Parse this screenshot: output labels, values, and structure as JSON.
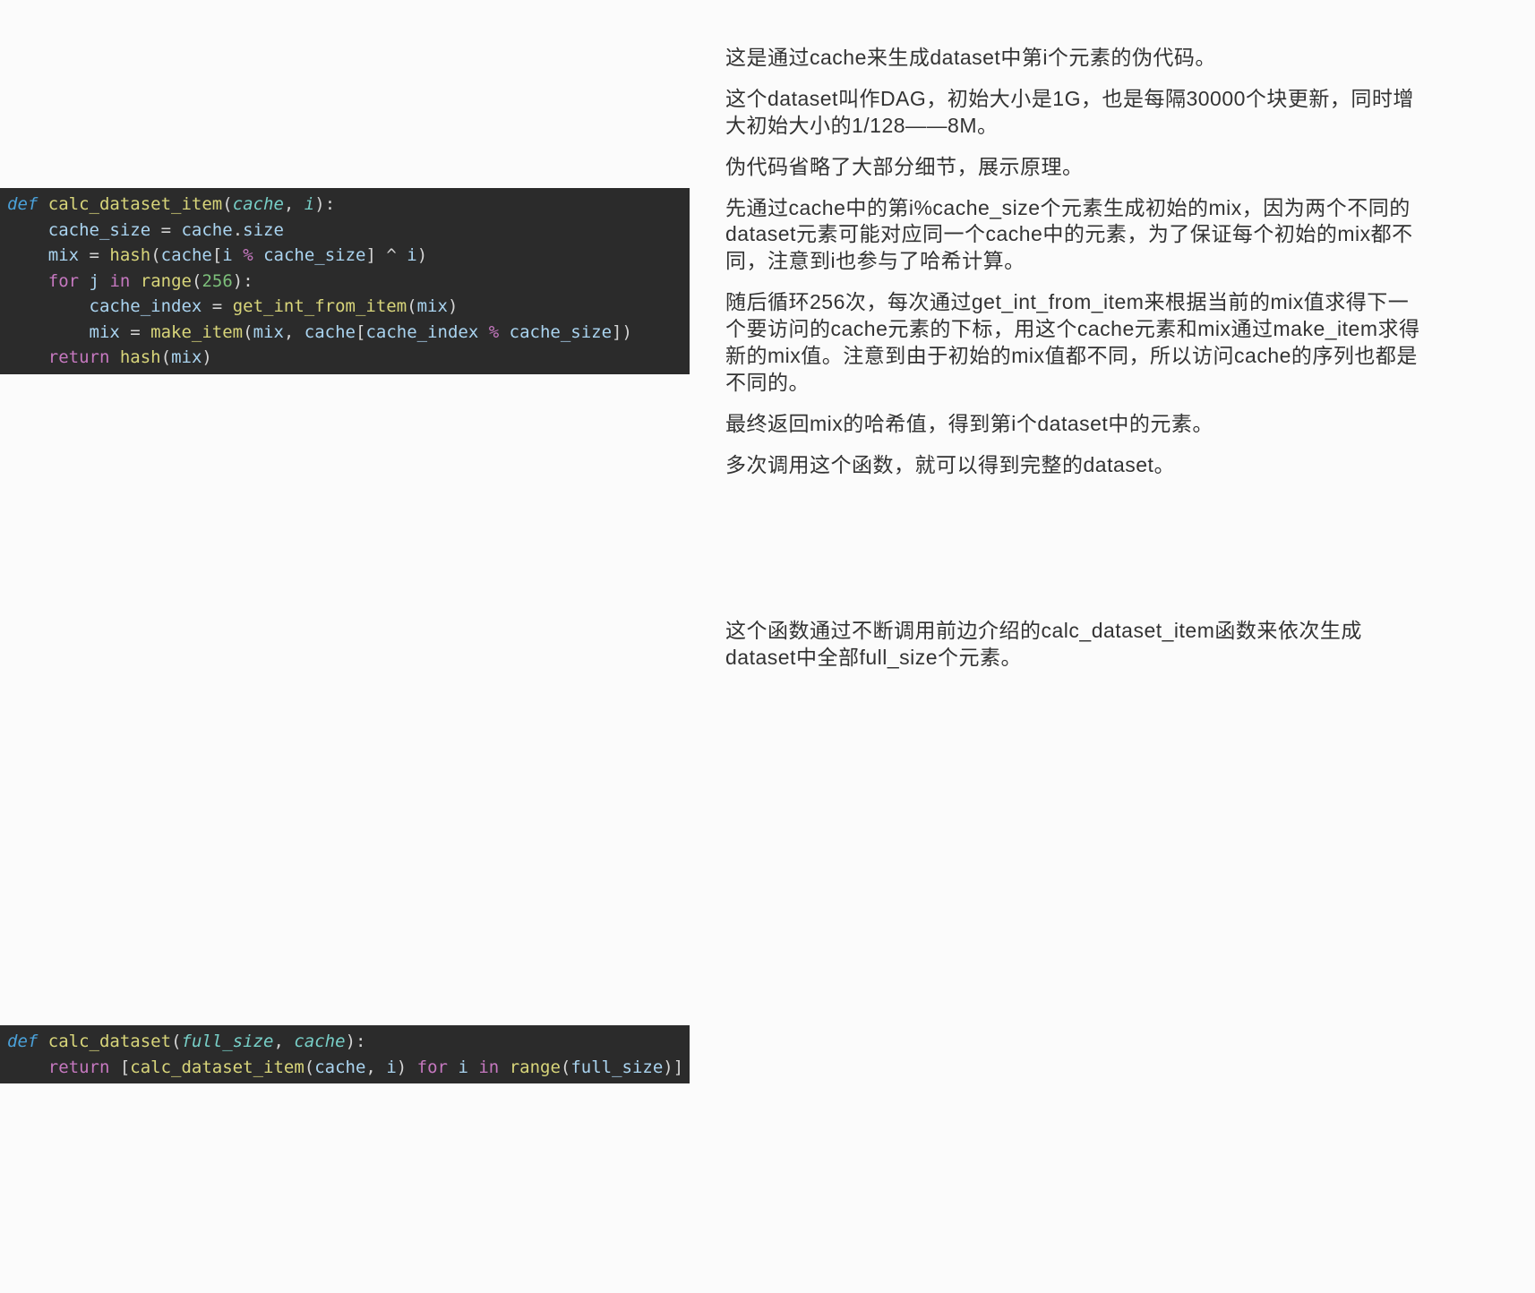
{
  "section1": {
    "code_lines": [
      [
        {
          "cls": "kw-def",
          "t": "def"
        },
        {
          "cls": "plain",
          "t": " "
        },
        {
          "cls": "fn-name",
          "t": "calc_dataset_item"
        },
        {
          "cls": "punct",
          "t": "("
        },
        {
          "cls": "param",
          "t": "cache"
        },
        {
          "cls": "punct",
          "t": ", "
        },
        {
          "cls": "param",
          "t": "i"
        },
        {
          "cls": "punct",
          "t": "):"
        }
      ],
      [
        {
          "cls": "plain",
          "t": "    "
        },
        {
          "cls": "var",
          "t": "cache_size"
        },
        {
          "cls": "plain",
          "t": " = "
        },
        {
          "cls": "var",
          "t": "cache"
        },
        {
          "cls": "punct",
          "t": "."
        },
        {
          "cls": "var",
          "t": "size"
        }
      ],
      [
        {
          "cls": "plain",
          "t": "    "
        },
        {
          "cls": "var",
          "t": "mix"
        },
        {
          "cls": "plain",
          "t": " = "
        },
        {
          "cls": "func",
          "t": "hash"
        },
        {
          "cls": "punct",
          "t": "("
        },
        {
          "cls": "var",
          "t": "cache"
        },
        {
          "cls": "punct",
          "t": "["
        },
        {
          "cls": "var",
          "t": "i"
        },
        {
          "cls": "plain",
          "t": " "
        },
        {
          "cls": "kw-ctrl",
          "t": "%"
        },
        {
          "cls": "plain",
          "t": " "
        },
        {
          "cls": "var",
          "t": "cache_size"
        },
        {
          "cls": "punct",
          "t": "] "
        },
        {
          "cls": "op",
          "t": "^"
        },
        {
          "cls": "plain",
          "t": " "
        },
        {
          "cls": "var",
          "t": "i"
        },
        {
          "cls": "punct",
          "t": ")"
        }
      ],
      [
        {
          "cls": "plain",
          "t": "    "
        },
        {
          "cls": "kw-ctrl",
          "t": "for"
        },
        {
          "cls": "plain",
          "t": " "
        },
        {
          "cls": "var",
          "t": "j"
        },
        {
          "cls": "plain",
          "t": " "
        },
        {
          "cls": "kw-ctrl",
          "t": "in"
        },
        {
          "cls": "plain",
          "t": " "
        },
        {
          "cls": "func",
          "t": "range"
        },
        {
          "cls": "punct",
          "t": "("
        },
        {
          "cls": "num",
          "t": "256"
        },
        {
          "cls": "punct",
          "t": "):"
        }
      ],
      [
        {
          "cls": "plain",
          "t": "        "
        },
        {
          "cls": "var",
          "t": "cache_index"
        },
        {
          "cls": "plain",
          "t": " = "
        },
        {
          "cls": "func",
          "t": "get_int_from_item"
        },
        {
          "cls": "punct",
          "t": "("
        },
        {
          "cls": "var",
          "t": "mix"
        },
        {
          "cls": "punct",
          "t": ")"
        }
      ],
      [
        {
          "cls": "plain",
          "t": "        "
        },
        {
          "cls": "var",
          "t": "mix"
        },
        {
          "cls": "plain",
          "t": " = "
        },
        {
          "cls": "func",
          "t": "make_item"
        },
        {
          "cls": "punct",
          "t": "("
        },
        {
          "cls": "var",
          "t": "mix"
        },
        {
          "cls": "punct",
          "t": ", "
        },
        {
          "cls": "var",
          "t": "cache"
        },
        {
          "cls": "punct",
          "t": "["
        },
        {
          "cls": "var",
          "t": "cache_index"
        },
        {
          "cls": "plain",
          "t": " "
        },
        {
          "cls": "kw-ctrl",
          "t": "%"
        },
        {
          "cls": "plain",
          "t": " "
        },
        {
          "cls": "var",
          "t": "cache_size"
        },
        {
          "cls": "punct",
          "t": "])"
        }
      ],
      [
        {
          "cls": "plain",
          "t": "    "
        },
        {
          "cls": "kw-ctrl",
          "t": "return"
        },
        {
          "cls": "plain",
          "t": " "
        },
        {
          "cls": "func",
          "t": "hash"
        },
        {
          "cls": "punct",
          "t": "("
        },
        {
          "cls": "var",
          "t": "mix"
        },
        {
          "cls": "punct",
          "t": ")"
        }
      ]
    ],
    "paras": [
      "这是通过cache来生成dataset中第i个元素的伪代码。",
      "这个dataset叫作DAG，初始大小是1G，也是每隔30000个块更新，同时增大初始大小的1/128——8M。",
      "伪代码省略了大部分细节，展示原理。",
      "先通过cache中的第i%cache_size个元素生成初始的mix，因为两个不同的dataset元素可能对应同一个cache中的元素，为了保证每个初始的mix都不同，注意到i也参与了哈希计算。",
      "随后循环256次，每次通过get_int_from_item来根据当前的mix值求得下一个要访问的cache元素的下标，用这个cache元素和mix通过make_item求得新的mix值。注意到由于初始的mix值都不同，所以访问cache的序列也都是不同的。",
      "最终返回mix的哈希值，得到第i个dataset中的元素。",
      "多次调用这个函数，就可以得到完整的dataset。"
    ]
  },
  "section2": {
    "code_lines": [
      [
        {
          "cls": "kw-def",
          "t": "def"
        },
        {
          "cls": "plain",
          "t": " "
        },
        {
          "cls": "fn-name",
          "t": "calc_dataset"
        },
        {
          "cls": "punct",
          "t": "("
        },
        {
          "cls": "param",
          "t": "full_size"
        },
        {
          "cls": "punct",
          "t": ", "
        },
        {
          "cls": "param",
          "t": "cache"
        },
        {
          "cls": "punct",
          "t": "):"
        }
      ],
      [
        {
          "cls": "plain",
          "t": "    "
        },
        {
          "cls": "kw-ctrl",
          "t": "return"
        },
        {
          "cls": "plain",
          "t": " ["
        },
        {
          "cls": "func",
          "t": "calc_dataset_item"
        },
        {
          "cls": "punct",
          "t": "("
        },
        {
          "cls": "var",
          "t": "cache"
        },
        {
          "cls": "punct",
          "t": ", "
        },
        {
          "cls": "var",
          "t": "i"
        },
        {
          "cls": "punct",
          "t": ") "
        },
        {
          "cls": "kw-ctrl",
          "t": "for"
        },
        {
          "cls": "plain",
          "t": " "
        },
        {
          "cls": "var",
          "t": "i"
        },
        {
          "cls": "plain",
          "t": " "
        },
        {
          "cls": "kw-ctrl",
          "t": "in"
        },
        {
          "cls": "plain",
          "t": " "
        },
        {
          "cls": "func",
          "t": "range"
        },
        {
          "cls": "punct",
          "t": "("
        },
        {
          "cls": "var",
          "t": "full_size"
        },
        {
          "cls": "punct",
          "t": ")]"
        }
      ]
    ],
    "paras": [
      "这个函数通过不断调用前边介绍的calc_dataset_item函数来依次生成dataset中全部full_size个元素。"
    ]
  }
}
